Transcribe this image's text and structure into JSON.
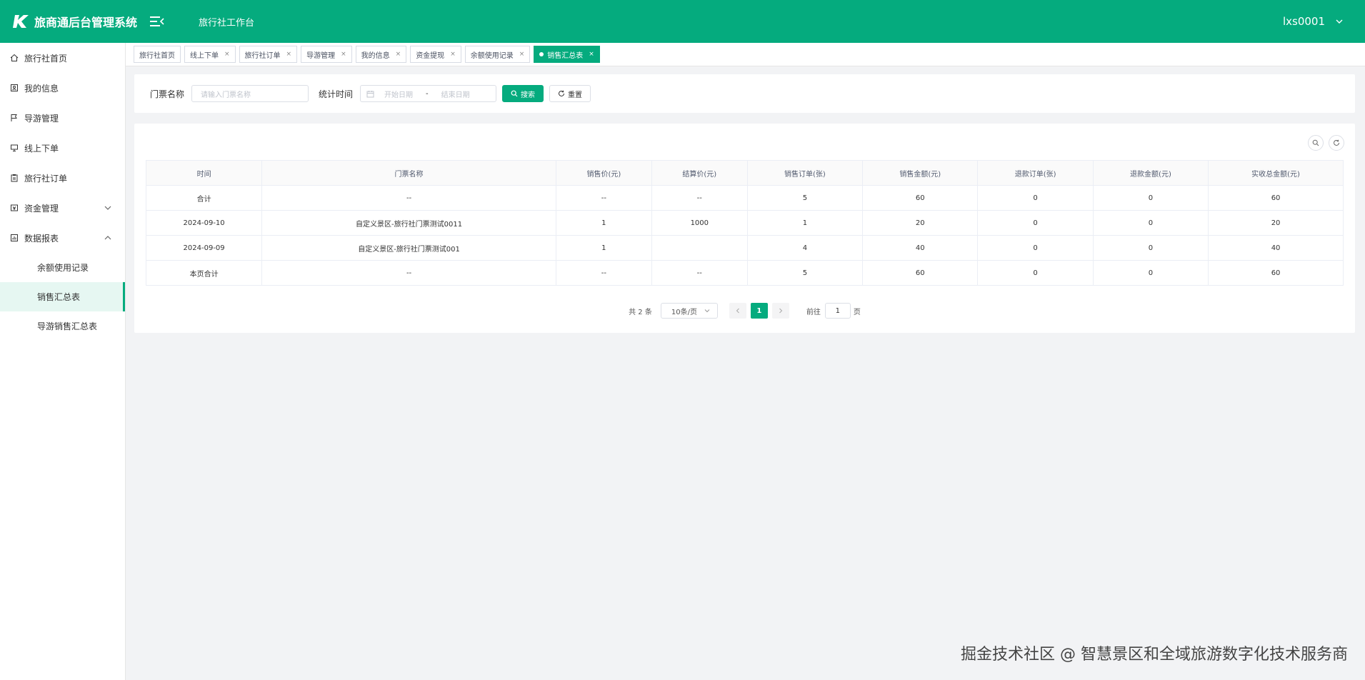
{
  "header": {
    "title": "旅商通后台管理系统",
    "workspace": "旅行社工作台",
    "user": "lxs0001"
  },
  "sidebar": {
    "items": [
      {
        "label": "旅行社首页",
        "icon": "home-icon"
      },
      {
        "label": "我的信息",
        "icon": "profile-icon"
      },
      {
        "label": "导游管理",
        "icon": "flag-icon"
      },
      {
        "label": "线上下单",
        "icon": "monitor-icon"
      },
      {
        "label": "旅行社订单",
        "icon": "clipboard-icon"
      },
      {
        "label": "资金管理",
        "icon": "wallet-icon"
      },
      {
        "label": "数据报表",
        "icon": "report-icon"
      }
    ],
    "subitems": [
      {
        "label": "余额使用记录"
      },
      {
        "label": "销售汇总表"
      },
      {
        "label": "导游销售汇总表"
      }
    ]
  },
  "tabs": [
    {
      "label": "旅行社首页"
    },
    {
      "label": "线上下单"
    },
    {
      "label": "旅行社订单"
    },
    {
      "label": "导游管理"
    },
    {
      "label": "我的信息"
    },
    {
      "label": "资金提现"
    },
    {
      "label": "余额使用记录"
    },
    {
      "label": "销售汇总表"
    }
  ],
  "search": {
    "ticket_label": "门票名称",
    "ticket_placeholder": "请输入门票名称",
    "time_label": "统计时间",
    "start_placeholder": "开始日期",
    "range_sep": "-",
    "end_placeholder": "结束日期",
    "search_button": "搜索",
    "reset_button": "重置"
  },
  "table": {
    "columns": [
      "时间",
      "门票名称",
      "销售价(元)",
      "结算价(元)",
      "销售订单(张)",
      "销售金额(元)",
      "退款订单(张)",
      "退款金额(元)",
      "实收总金额(元)"
    ],
    "rows": [
      [
        "合计",
        "--",
        "--",
        "--",
        "5",
        "60",
        "0",
        "0",
        "60"
      ],
      [
        "2024-09-10",
        "自定义景区-旅行社门票测试0011",
        "1",
        "1000",
        "1",
        "20",
        "0",
        "0",
        "20"
      ],
      [
        "2024-09-09",
        "自定义景区-旅行社门票测试001",
        "1",
        "",
        "4",
        "40",
        "0",
        "0",
        "40"
      ],
      [
        "本页合计",
        "--",
        "--",
        "--",
        "5",
        "60",
        "0",
        "0",
        "60"
      ]
    ]
  },
  "pager": {
    "total": "共 2 条",
    "page_size": "10条/页",
    "current": "1",
    "goto_label": "前往",
    "goto_value": "1",
    "page_unit": "页"
  },
  "watermark": "掘金技术社区 @ 智慧景区和全域旅游数字化技术服务商",
  "colors": {
    "accent": "#05ab7e"
  }
}
